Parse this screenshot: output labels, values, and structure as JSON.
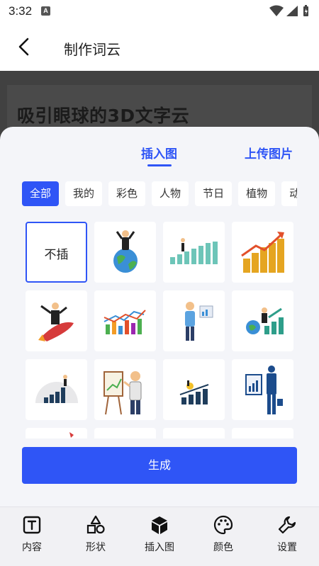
{
  "status_bar": {
    "time": "3:32",
    "notification_letter": "A"
  },
  "app_bar": {
    "title": "制作词云"
  },
  "preview": {
    "text": "吸引眼球的3D文字云"
  },
  "sheet": {
    "tabs": [
      {
        "label": "插入图",
        "active": true
      },
      {
        "label": "上传图片",
        "active": false
      }
    ],
    "categories": [
      "全部",
      "我的",
      "彩色",
      "人物",
      "节日",
      "植物",
      "动物"
    ],
    "tiles": [
      {
        "label": "不插",
        "icon": "none-option",
        "selected": true
      },
      {
        "icon": "businessman-on-globe-image"
      },
      {
        "icon": "man-climbing-bar-chart-image"
      },
      {
        "icon": "gold-coin-stacks-growth-image"
      },
      {
        "icon": "businessman-riding-rocket-image"
      },
      {
        "icon": "colorful-bar-line-chart-image"
      },
      {
        "icon": "man-presenting-chart-image"
      },
      {
        "icon": "people-globe-growth-chart-image"
      },
      {
        "icon": "semicircle-bar-chart-image"
      },
      {
        "icon": "man-presenting-easel-image"
      },
      {
        "icon": "person-flag-bar-chart-image"
      },
      {
        "icon": "businessman-document-chart-image"
      }
    ],
    "generate_label": "生成"
  },
  "bottom_nav": [
    {
      "label": "内容",
      "icon": "text-icon"
    },
    {
      "label": "形状",
      "icon": "shapes-icon"
    },
    {
      "label": "插入图",
      "icon": "cube-icon"
    },
    {
      "label": "颜色",
      "icon": "palette-icon"
    },
    {
      "label": "设置",
      "icon": "wrench-icon"
    }
  ],
  "colors": {
    "accent": "#2f55f6",
    "sheet_bg": "#f4f5f9",
    "nav_bg": "#f1f1f4"
  }
}
